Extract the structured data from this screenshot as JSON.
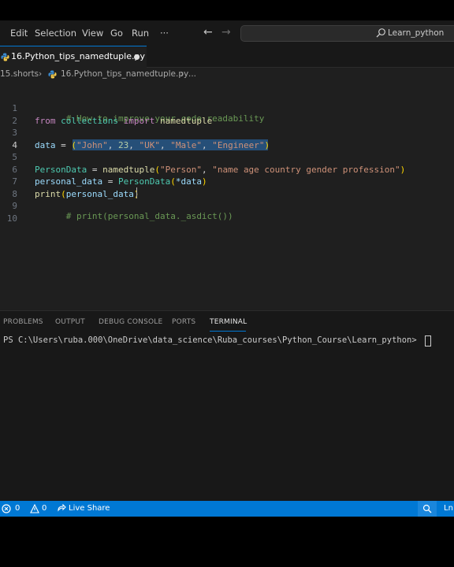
{
  "menu": {
    "items": [
      "Edit",
      "Selection",
      "View",
      "Go",
      "Run"
    ],
    "more": "···",
    "back_arrow": "←",
    "forward_arrow": "→"
  },
  "search": {
    "text": "Learn_python",
    "icon": "search-icon"
  },
  "tab": {
    "label": "16.Python_tips_namedtuple.py",
    "modified": true
  },
  "breadcrumb": {
    "folder": "15.shorts",
    "sep": "›",
    "file": "16.Python_tips_namedtuple.py",
    "sep2": "›",
    "more": "..."
  },
  "editor": {
    "line_numbers": [
      "1",
      "2",
      "3",
      "4",
      "5",
      "6",
      "7",
      "8",
      "9",
      "10"
    ],
    "lines": {
      "l1": "# How to improve your code readability",
      "l2_from": "from",
      "l2_mod": "collections",
      "l2_import": "import",
      "l2_name": "namedtuple",
      "l4_var": "data",
      "l4_eq": " = ",
      "l4_open": "(",
      "l4_s1": "\"John\"",
      "l4_c1": ", ",
      "l4_n1": "23",
      "l4_c2": ", ",
      "l4_s2": "\"UK\"",
      "l4_c3": ", ",
      "l4_s3": "\"Male\"",
      "l4_c4": ", ",
      "l4_s4": "\"Engineer\"",
      "l4_close": ")",
      "l6_cls": "PersonData",
      "l6_eq": " = ",
      "l6_fn": "namedtuple",
      "l6_open": "(",
      "l6_s1": "\"Person\"",
      "l6_c": ", ",
      "l6_s2": "\"name age country gender profession\"",
      "l6_close": ")",
      "l7_var": "personal_data",
      "l7_eq": " = ",
      "l7_cls": "PersonData",
      "l7_open": "(",
      "l7_arg": "*data",
      "l7_close": ")",
      "l8_fn": "print",
      "l8_open": "(",
      "l8_arg": "personal_data",
      "l8_close": ")",
      "l9": "# print(personal_data._asdict())"
    }
  },
  "panel": {
    "tabs": [
      "PROBLEMS",
      "OUTPUT",
      "DEBUG CONSOLE",
      "PORTS",
      "TERMINAL"
    ],
    "active_tab": "TERMINAL",
    "terminal_prompt": "PS C:\\Users\\ruba.000\\OneDrive\\data_science\\Ruba_courses\\Python_Course\\Learn_python> "
  },
  "statusbar": {
    "errors": "0",
    "warnings": "0",
    "live_share": "Live Share",
    "position": "Ln"
  },
  "colors": {
    "accent": "#0078d4",
    "status_bar": "#0078d4",
    "selection": "#264f78"
  }
}
